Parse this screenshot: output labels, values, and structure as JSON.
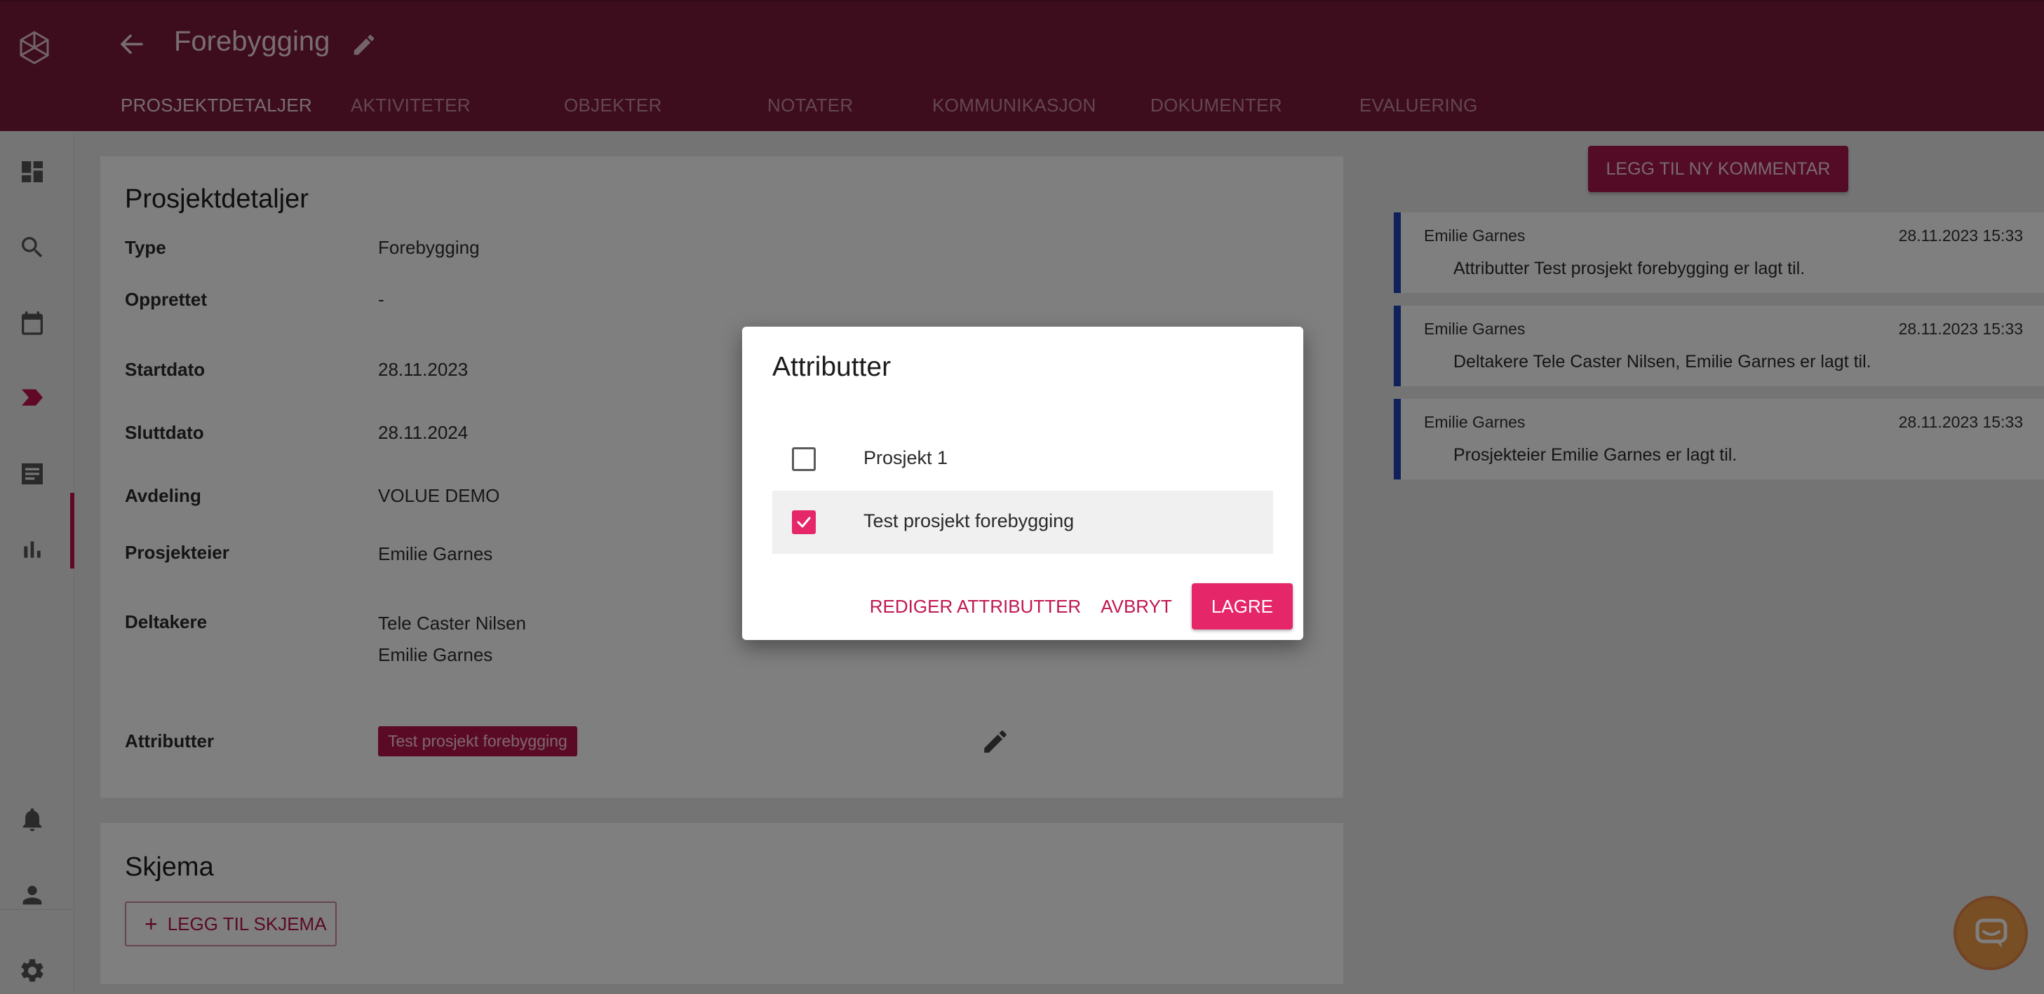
{
  "colors": {
    "header": "#7a1a3a",
    "accent": "#e5276a",
    "chip": "#b7154b",
    "comment_border": "#1f40b8",
    "chat": "#f19c4a"
  },
  "header": {
    "title": "Forebygging",
    "icons": [
      "logo-icon",
      "back-arrow-icon",
      "edit-pencil-icon"
    ],
    "tabs": [
      {
        "label": "PROSJEKTDETALJER",
        "active": true
      },
      {
        "label": "AKTIVITETER"
      },
      {
        "label": "OBJEKTER"
      },
      {
        "label": "NOTATER"
      },
      {
        "label": "KOMMUNIKASJON"
      },
      {
        "label": "DOKUMENTER"
      },
      {
        "label": "EVALUERING"
      }
    ]
  },
  "sidebar": {
    "items": [
      "dashboard-icon",
      "search-icon",
      "calendar-icon",
      "project-tag-icon",
      "list-icon",
      "bar-chart-icon"
    ],
    "bottom": [
      "bell-icon",
      "person-icon",
      "gear-icon"
    ],
    "active_index": 3
  },
  "details": {
    "title": "Prosjektdetaljer",
    "fields": [
      {
        "label": "Type",
        "value": "Forebygging"
      },
      {
        "label": "Opprettet",
        "value": "-"
      },
      {
        "label": "Startdato",
        "value": "28.11.2023"
      },
      {
        "label": "Sluttdato",
        "value": "28.11.2024"
      },
      {
        "label": "Avdeling",
        "value": "VOLUE DEMO"
      },
      {
        "label": "Prosjekteier",
        "value": "Emilie Garnes"
      },
      {
        "label": "Deltakere",
        "values": [
          "Tele Caster Nilsen",
          "Emilie Garnes"
        ]
      },
      {
        "label": "Attributter",
        "chip": "Test prosjekt forebygging"
      }
    ]
  },
  "schema": {
    "title": "Skjema",
    "add_label": "LEGG TIL SKJEMA"
  },
  "comments": {
    "add_button": "LEGG TIL NY KOMMENTAR",
    "items": [
      {
        "author": "Emilie Garnes",
        "time": "28.11.2023 15:33",
        "text": "Attributter Test prosjekt forebygging er lagt til."
      },
      {
        "author": "Emilie Garnes",
        "time": "28.11.2023 15:33",
        "text": "Deltakere Tele Caster Nilsen, Emilie Garnes er lagt til."
      },
      {
        "author": "Emilie Garnes",
        "time": "28.11.2023 15:33",
        "text": "Prosjekteier Emilie Garnes er lagt til."
      }
    ]
  },
  "dialog": {
    "title": "Attributter",
    "options": [
      {
        "label": "Prosjekt 1",
        "checked": false
      },
      {
        "label": "Test prosjekt forebygging",
        "checked": true
      }
    ],
    "edit_label": "REDIGER ATTRIBUTTER",
    "cancel_label": "AVBRYT",
    "save_label": "LAGRE"
  }
}
